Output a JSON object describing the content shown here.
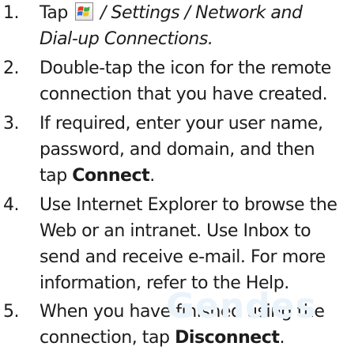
{
  "steps": [
    {
      "number": "1.",
      "lines": [
        {
          "before_icon": "Tap ",
          "start_icon": "windows-start-icon",
          "after_icon": " / Settings / Network and"
        },
        {
          "text": "Dial-up Connections."
        }
      ]
    },
    {
      "number": "2.",
      "lines": [
        {
          "text": "Double-tap the icon for the remote"
        },
        {
          "text": "connection that you have created."
        }
      ]
    },
    {
      "number": "3.",
      "lines": [
        {
          "text": "If required, enter your user name,"
        },
        {
          "text": "password, and domain, and then"
        },
        {
          "before": "tap ",
          "bold": "Connect",
          "after": "."
        }
      ]
    },
    {
      "number": "4.",
      "lines": [
        {
          "text": "Use Internet Explorer to browse the"
        },
        {
          "text": "Web or an intranet. Use Inbox to"
        },
        {
          "text": "send and receive e-mail. For more"
        },
        {
          "text": "information, refer to the Help."
        }
      ]
    },
    {
      "number": "5.",
      "lines": [
        {
          "text": "When you have finished using the"
        },
        {
          "before": "connection, tap ",
          "bold": "Disconnect",
          "after": "."
        }
      ]
    }
  ],
  "watermark": "Gendes",
  "colors": {
    "text": "#1c1c1c",
    "watermark": "#eaf3fa",
    "icon_red": "#e23a21",
    "icon_green": "#3cae3c",
    "icon_blue": "#2f6fd6",
    "icon_yellow": "#f2c21a"
  }
}
